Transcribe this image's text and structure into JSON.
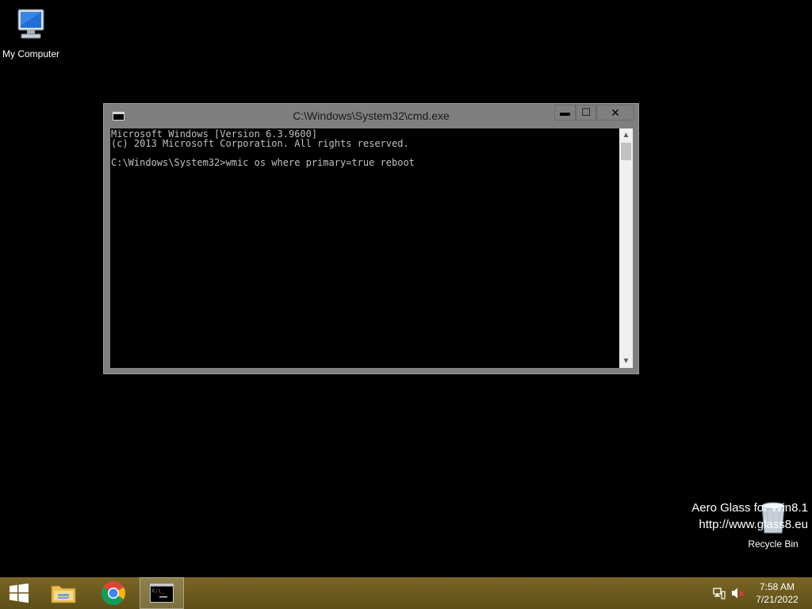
{
  "desktop": {
    "icons": [
      {
        "label": "My Computer",
        "icon": "computer-icon"
      },
      {
        "label": "Recycle Bin",
        "icon": "recycle-bin-icon"
      }
    ],
    "watermark": {
      "line1": "Aero Glass for Win8.1",
      "line2": "http://www.glass8.eu"
    }
  },
  "cmd_window": {
    "title": "C:\\Windows\\System32\\cmd.exe",
    "buttons": {
      "minimize": "▬",
      "maximize": "☐",
      "close": "✕"
    },
    "console_lines": [
      "Microsoft Windows [Version 6.3.9600]",
      "(c) 2013 Microsoft Corporation. All rights reserved.",
      "",
      "C:\\Windows\\System32>wmic os where primary=true reboot"
    ]
  },
  "taskbar": {
    "items": [
      {
        "name": "start",
        "icon": "windows-logo-icon"
      },
      {
        "name": "file-explorer",
        "icon": "folder-icon"
      },
      {
        "name": "chrome",
        "icon": "chrome-icon"
      },
      {
        "name": "cmd",
        "icon": "cmd-icon",
        "active": true
      }
    ],
    "tray": {
      "network_icon": "network-icon",
      "volume_icon": "volume-muted-icon"
    },
    "clock": {
      "time": "7:58 AM",
      "date": "7/21/2022"
    }
  },
  "colors": {
    "taskbar": "#6b5a1f",
    "window_frame": "#7f7f7f",
    "console_bg": "#000000",
    "console_fg": "#c0c0c0"
  }
}
